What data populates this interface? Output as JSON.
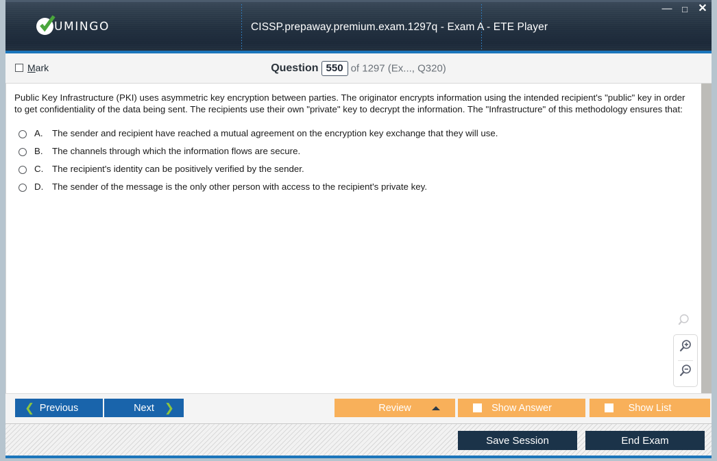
{
  "window": {
    "title": "CISSP.prepaway.premium.exam.1297q - Exam A - ETE Player",
    "logo_text": "UMINGO",
    "controls": {
      "minimize": "—",
      "maximize": "□",
      "close": "✕"
    }
  },
  "qbar": {
    "mark_label_first": "M",
    "mark_label_rest": "ark",
    "question_label": "Question",
    "question_number": "550",
    "rest": "of 1297 (Ex..., Q320)"
  },
  "question": {
    "text": "Public Key Infrastructure (PKI) uses asymmetric key encryption between parties. The originator encrypts information using the intended recipient's \"public\" key in order to get confidentiality of the data being sent. The recipients use their own \"private\" key to decrypt the information. The \"Infrastructure\" of this methodology ensures that:",
    "options": [
      {
        "letter": "A.",
        "text": "The sender and recipient have reached a mutual agreement on the encryption key exchange that they will use."
      },
      {
        "letter": "B.",
        "text": "The channels through which the information flows are secure."
      },
      {
        "letter": "C.",
        "text": "The recipient's identity can be positively verified by the sender."
      },
      {
        "letter": "D.",
        "text": "The sender of the message is the only other person with access to the recipient's private key."
      }
    ]
  },
  "toolbar": {
    "previous_label": "Previous",
    "next_label": "Next",
    "review_label": "Review",
    "show_answer_label": "Show Answer",
    "show_list_label": "Show List",
    "prev_chevron": "❮",
    "next_chevron": "❯"
  },
  "bottom": {
    "save_session_label": "Save Session",
    "end_exam_label": "End Exam"
  },
  "colors": {
    "accent_blue": "#1b75bb",
    "button_blue": "#1964ab",
    "button_orange": "#f8b05a",
    "button_dark": "#1b3349",
    "chevron_green": "#8dc63f",
    "header_dark": "#22303f"
  }
}
